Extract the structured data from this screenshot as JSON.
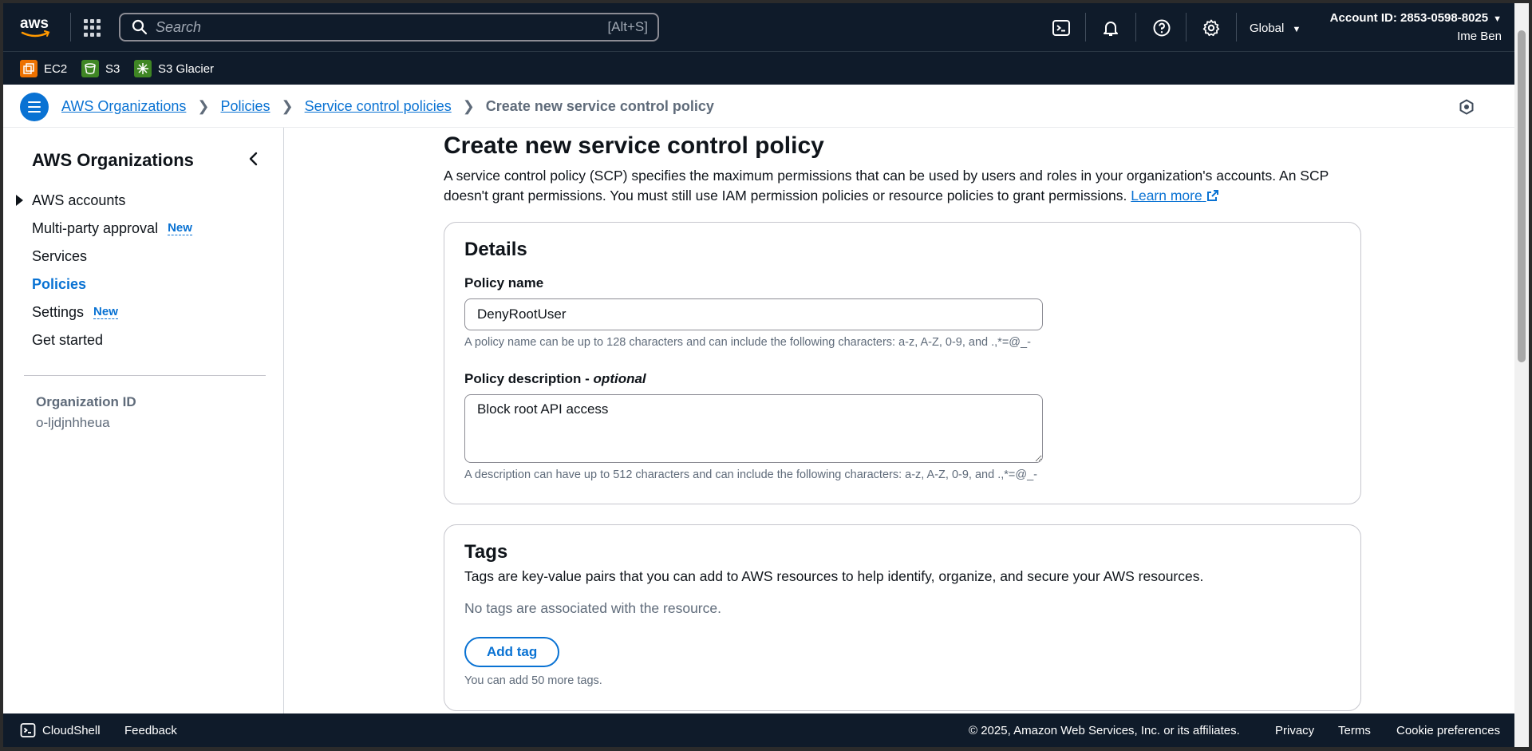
{
  "topnav": {
    "logo": "aws",
    "search_placeholder": "Search",
    "search_shortcut": "[Alt+S]",
    "region": "Global",
    "account_id": "Account ID: 2853-0598-8025",
    "user": "Ime Ben",
    "icons": [
      "cloudshell-icon",
      "bell-icon",
      "help-icon",
      "gear-icon"
    ]
  },
  "favorites": [
    {
      "label": "EC2",
      "color": "#ed7100"
    },
    {
      "label": "S3",
      "color": "#3f8624"
    },
    {
      "label": "S3 Glacier",
      "color": "#3f8624"
    }
  ],
  "breadcrumb": {
    "items": [
      "AWS Organizations",
      "Policies",
      "Service control policies"
    ],
    "current": "Create new service control policy"
  },
  "sidebar": {
    "title": "AWS Organizations",
    "items": [
      {
        "label": "AWS accounts",
        "badge": ""
      },
      {
        "label": "Multi-party approval",
        "badge": "New"
      },
      {
        "label": "Services",
        "badge": ""
      },
      {
        "label": "Policies",
        "badge": ""
      },
      {
        "label": "Settings",
        "badge": "New"
      },
      {
        "label": "Get started",
        "badge": ""
      }
    ],
    "org_id_label": "Organization ID",
    "org_id_value": "o-ljdjnhheua"
  },
  "main": {
    "title": "Create new service control policy",
    "description": "A service control policy (SCP) specifies the maximum permissions that can be used by users and roles in your organization's accounts. An SCP doesn't grant permissions. You must still use IAM permission policies or resource policies to grant permissions.",
    "learn_more": "Learn more",
    "details": {
      "heading": "Details",
      "name_label": "Policy name",
      "name_value": "DenyRootUser",
      "name_hint": "A policy name can be up to 128 characters and can include the following characters: a-z, A-Z, 0-9, and .,*=@_-",
      "desc_label": "Policy description - ",
      "desc_optional": "optional",
      "desc_value": "Block root API access",
      "desc_hint": "A description can have up to 512 characters and can include the following characters: a-z, A-Z, 0-9, and .,*=@_-"
    },
    "tags": {
      "heading": "Tags",
      "description": "Tags are key-value pairs that you can add to AWS resources to help identify, organize, and secure your AWS resources.",
      "empty": "No tags are associated with the resource.",
      "add_button": "Add tag",
      "limit": "You can add 50 more tags."
    }
  },
  "footer": {
    "cloudshell": "CloudShell",
    "feedback": "Feedback",
    "copyright": "© 2025, Amazon Web Services, Inc. or its affiliates.",
    "privacy": "Privacy",
    "terms": "Terms",
    "cookies": "Cookie preferences"
  },
  "colors": {
    "nav_bg": "#0f1b2a",
    "link": "#0972d3",
    "muted": "#5f6b7a"
  }
}
